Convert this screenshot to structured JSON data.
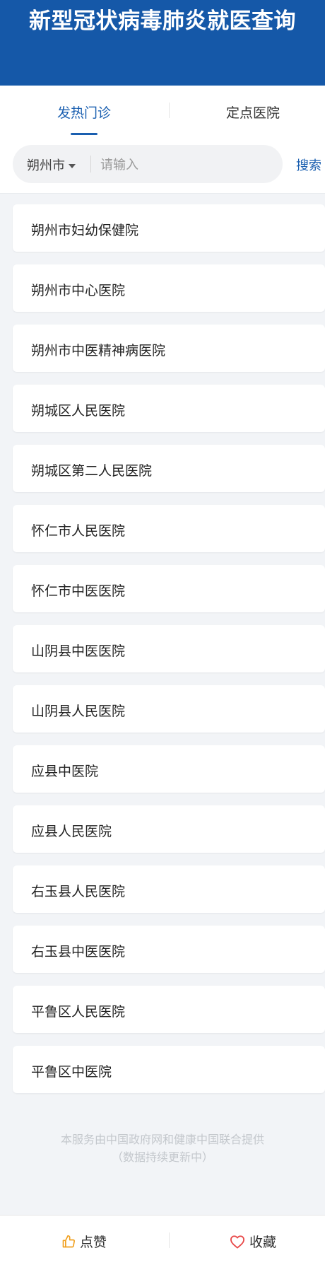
{
  "header": {
    "title": "新型冠状病毒肺炎就医查询"
  },
  "tabs": [
    {
      "label": "发热门诊",
      "active": true
    },
    {
      "label": "定点医院",
      "active": false
    }
  ],
  "search": {
    "city": "朔州市",
    "placeholder": "请输入",
    "button_label": "搜索"
  },
  "hospitals": [
    "朔州市妇幼保健院",
    "朔州市中心医院",
    "朔州市中医精神病医院",
    "朔城区人民医院",
    "朔城区第二人民医院",
    "怀仁市人民医院",
    "怀仁市中医医院",
    "山阴县中医医院",
    "山阴县人民医院",
    "应县中医院",
    "应县人民医院",
    "右玉县人民医院",
    "右玉县中医医院",
    "平鲁区人民医院",
    "平鲁区中医院"
  ],
  "footer": {
    "line1": "本服务由中国政府网和健康中国联合提供",
    "line2": "（数据持续更新中）"
  },
  "bottom_bar": {
    "like_label": "点赞",
    "favorite_label": "收藏"
  },
  "colors": {
    "header_bg": "#1558a8",
    "accent": "#1a5fb0",
    "like_icon": "#f0a020",
    "favorite_icon": "#e84a4a"
  },
  "icons": {
    "like": "thumbs-up-icon",
    "favorite": "heart-icon",
    "dropdown": "caret-down-icon"
  }
}
